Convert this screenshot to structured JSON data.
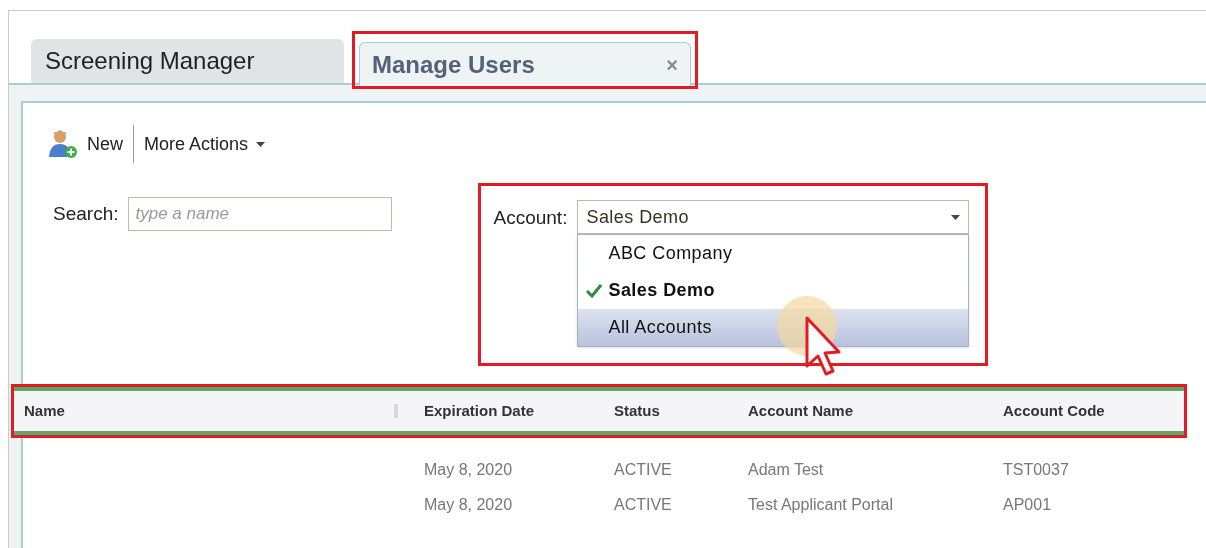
{
  "tabs": [
    {
      "label": "Screening Manager",
      "selected": false,
      "closable": false,
      "highlighted": false
    },
    {
      "label": "Manage Users",
      "selected": true,
      "closable": true,
      "highlighted": true
    }
  ],
  "close_glyph": "×",
  "toolbar": {
    "new_label": "New",
    "more_actions_label": "More Actions"
  },
  "search": {
    "label": "Search:",
    "placeholder": "type a name"
  },
  "account": {
    "label": "Account:",
    "value": "Sales Demo",
    "highlighted": true,
    "expanded": true,
    "options": [
      {
        "label": "ABC Company",
        "selected": false,
        "hovered": false
      },
      {
        "label": "Sales Demo",
        "selected": true,
        "hovered": false
      },
      {
        "label": "All Accounts",
        "selected": false,
        "hovered": true
      }
    ]
  },
  "table": {
    "highlighted": true,
    "columns": [
      "Name",
      "Expiration Date",
      "Status",
      "Account Name",
      "Account Code"
    ],
    "rows": [
      {
        "name": "",
        "expiration_date": "May 8, 2020",
        "status": "ACTIVE",
        "account_name": "Adam Test",
        "account_code": "TST0037"
      },
      {
        "name": "",
        "expiration_date": "May 8, 2020",
        "status": "ACTIVE",
        "account_name": "Test Applicant Portal",
        "account_code": "AP001"
      }
    ]
  }
}
